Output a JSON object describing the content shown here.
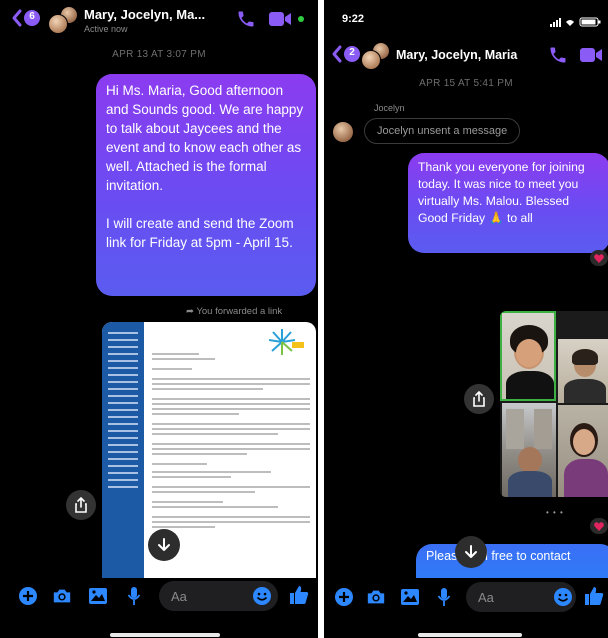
{
  "left": {
    "header": {
      "badge": "6",
      "name": "Mary, Jocelyn, Ma...",
      "status": "Active now"
    },
    "timestamp": "APR 13 AT 3:07 PM",
    "message": {
      "para1": "Hi Ms. Maria, Good afternoon and Sounds good. We are happy to talk about Jaycees and the event and to know each other as well. Attached is the formal invitation.",
      "para2": "I will create and send the Zoom link for Friday at 5pm - April 15."
    },
    "forward_note": "You forwarded a link",
    "composer": {
      "placeholder": "Aa"
    }
  },
  "right": {
    "status_bar": {
      "time": "9:22"
    },
    "header": {
      "badge": "2",
      "name": "Mary, Jocelyn, Maria"
    },
    "timestamp": "APR 15 AT 5:41 PM",
    "sender_label": "Jocelyn",
    "unsent_note": "Jocelyn unsent a message",
    "message": "Thank you everyone for joining today. It was nice to meet you virtually Ms. Malou. Blessed Good Friday 🙏 to all",
    "dots": "• • •",
    "partial_message": "Please feel free to contact",
    "composer": {
      "placeholder": "Aa"
    }
  },
  "colors": {
    "accent": "#8a5cf5",
    "active_dot": "#2ecc40",
    "reaction": "#e0245e"
  }
}
